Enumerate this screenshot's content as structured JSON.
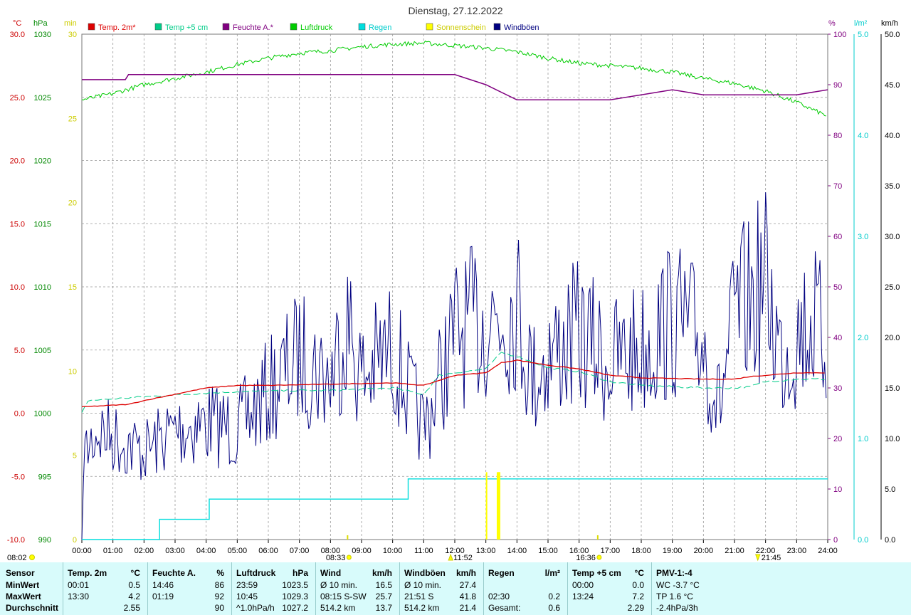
{
  "chart_data": {
    "type": "line",
    "title": "Dienstag, 27.12.2022",
    "axes": {
      "temp": {
        "unit": "°C",
        "min": -10,
        "max": 30,
        "ticks": [
          "-10.0",
          "-5.0",
          "0.0",
          "5.0",
          "10.0",
          "15.0",
          "20.0",
          "25.0",
          "30.0"
        ],
        "color": "#cc0000"
      },
      "press": {
        "unit": "hPa",
        "min": 990,
        "max": 1030,
        "ticks": [
          "990",
          "995",
          "1000",
          "1005",
          "1010",
          "1015",
          "1020",
          "1025",
          "1030"
        ],
        "color": "#008800"
      },
      "sun": {
        "unit": "min",
        "min": 0,
        "max": 30,
        "ticks": [
          "0",
          "5",
          "10",
          "15",
          "20",
          "25",
          "30"
        ],
        "color": "#cccc00"
      },
      "hum": {
        "unit": "%",
        "min": 0,
        "max": 100,
        "ticks": [
          "0",
          "10",
          "20",
          "30",
          "40",
          "50",
          "60",
          "70",
          "80",
          "90",
          "100"
        ],
        "color": "#800080"
      },
      "rain": {
        "unit": "l/m²",
        "min": 0,
        "max": 5,
        "ticks": [
          "0.0",
          "1.0",
          "2.0",
          "3.0",
          "4.0",
          "5.0"
        ],
        "color": "#00cccc"
      },
      "wind": {
        "unit": "km/h",
        "min": 0,
        "max": 50,
        "ticks": [
          "0.0",
          "5.0",
          "10.0",
          "15.0",
          "20.0",
          "25.0",
          "30.0",
          "35.0",
          "40.0",
          "45.0",
          "50.0"
        ],
        "color": "#000000"
      }
    },
    "x_ticks": [
      "00:00",
      "01:00",
      "02:00",
      "03:00",
      "04:00",
      "05:00",
      "06:00",
      "07:00",
      "08:00",
      "09:00",
      "10:00",
      "11:00",
      "12:00",
      "13:00",
      "14:00",
      "15:00",
      "16:00",
      "17:00",
      "18:00",
      "19:00",
      "20:00",
      "21:00",
      "22:00",
      "23:00",
      "24:00"
    ],
    "legend": [
      {
        "name": "Temp. 2m*",
        "color": "#dd0000"
      },
      {
        "name": "Temp +5 cm",
        "color": "#00cc88"
      },
      {
        "name": "Feuchte A.*",
        "color": "#800080"
      },
      {
        "name": "Luftdruck",
        "color": "#00cc00"
      },
      {
        "name": "Regen",
        "color": "#00dddd"
      },
      {
        "name": "Sonnenschein",
        "color": "#ffff00"
      },
      {
        "name": "Windböen",
        "color": "#000080"
      }
    ],
    "series": {
      "temp2m": [
        [
          0,
          0.5
        ],
        [
          1.5,
          0.7
        ],
        [
          2,
          1.0
        ],
        [
          3,
          1.5
        ],
        [
          4,
          2.0
        ],
        [
          5,
          2.2
        ],
        [
          6,
          2.2
        ],
        [
          8,
          2.3
        ],
        [
          10,
          2.4
        ],
        [
          11,
          2.2
        ],
        [
          11.5,
          2.6
        ],
        [
          12,
          3.0
        ],
        [
          13,
          3.2
        ],
        [
          13.5,
          4.0
        ],
        [
          14,
          4.2
        ],
        [
          15,
          3.8
        ],
        [
          16,
          3.5
        ],
        [
          17,
          3.0
        ],
        [
          18,
          2.8
        ],
        [
          20,
          2.7
        ],
        [
          21,
          2.7
        ],
        [
          21.5,
          2.9
        ],
        [
          22,
          3.0
        ],
        [
          23,
          3.2
        ],
        [
          24,
          3.2
        ]
      ],
      "temp5cm": [
        [
          0,
          0.0
        ],
        [
          0.2,
          1.0
        ],
        [
          2,
          1.3
        ],
        [
          4,
          1.6
        ],
        [
          5,
          1.7
        ],
        [
          7,
          1.8
        ],
        [
          8,
          1.8
        ],
        [
          10,
          2.0
        ],
        [
          11,
          1.5
        ],
        [
          11.5,
          3.0
        ],
        [
          12,
          3.2
        ],
        [
          13,
          3.5
        ],
        [
          13.5,
          4.8
        ],
        [
          14,
          4.5
        ],
        [
          15,
          3.6
        ],
        [
          16,
          3.3
        ],
        [
          17,
          2.5
        ],
        [
          18,
          2.2
        ],
        [
          20,
          2.0
        ],
        [
          21,
          2.0
        ],
        [
          21.5,
          2.1
        ],
        [
          22,
          2.5
        ],
        [
          23,
          2.7
        ],
        [
          24,
          2.7
        ]
      ],
      "humidity": [
        [
          0,
          91
        ],
        [
          1.4,
          91
        ],
        [
          1.5,
          92
        ],
        [
          12,
          92
        ],
        [
          13,
          90
        ],
        [
          14,
          87
        ],
        [
          15,
          87
        ],
        [
          17,
          87
        ],
        [
          18,
          88
        ],
        [
          19,
          89
        ],
        [
          20,
          88
        ],
        [
          22,
          88
        ],
        [
          23,
          88
        ],
        [
          24,
          89
        ]
      ],
      "pressure": [
        [
          0,
          1024.8
        ],
        [
          1,
          1025.3
        ],
        [
          2,
          1026.0
        ],
        [
          3,
          1026.5
        ],
        [
          4,
          1027.0
        ],
        [
          5,
          1027.6
        ],
        [
          6,
          1028.1
        ],
        [
          7,
          1028.5
        ],
        [
          8,
          1028.7
        ],
        [
          9,
          1029.0
        ],
        [
          10,
          1029.2
        ],
        [
          11,
          1029.3
        ],
        [
          12,
          1029.1
        ],
        [
          13,
          1028.9
        ],
        [
          14,
          1028.6
        ],
        [
          15,
          1028.1
        ],
        [
          16,
          1027.7
        ],
        [
          17,
          1027.5
        ],
        [
          18,
          1027.3
        ],
        [
          19,
          1027.0
        ],
        [
          20,
          1026.5
        ],
        [
          21,
          1026.1
        ],
        [
          22,
          1025.5
        ],
        [
          23,
          1024.6
        ],
        [
          24,
          1023.5
        ]
      ],
      "rain": [
        [
          0,
          0
        ],
        [
          2.5,
          0
        ],
        [
          2.5,
          0.2
        ],
        [
          4.1,
          0.2
        ],
        [
          4.1,
          0.4
        ],
        [
          10.5,
          0.4
        ],
        [
          10.5,
          0.6
        ],
        [
          24,
          0.6
        ]
      ],
      "sunshine": [
        [
          13.0,
          2.5
        ],
        [
          13.35,
          2.5
        ],
        [
          13.4,
          2.5
        ]
      ],
      "wind_gusts_envelope": [
        [
          0,
          11
        ],
        [
          0.5,
          15
        ],
        [
          1,
          14
        ],
        [
          2,
          12
        ],
        [
          3,
          15
        ],
        [
          4,
          16
        ],
        [
          5,
          15
        ],
        [
          6,
          20
        ],
        [
          7,
          25
        ],
        [
          8,
          22
        ],
        [
          8.5,
          30
        ],
        [
          9,
          22
        ],
        [
          10,
          26
        ],
        [
          10.5,
          20
        ],
        [
          11,
          15
        ],
        [
          12,
          28
        ],
        [
          13,
          30
        ],
        [
          14,
          32
        ],
        [
          14.5,
          22
        ],
        [
          15,
          25
        ],
        [
          16,
          28
        ],
        [
          17,
          24
        ],
        [
          18,
          26
        ],
        [
          19,
          30
        ],
        [
          20,
          27
        ],
        [
          20.5,
          18
        ],
        [
          21,
          30
        ],
        [
          22,
          35
        ],
        [
          22.5,
          25
        ],
        [
          23,
          28
        ],
        [
          23.5,
          30
        ],
        [
          24,
          26
        ]
      ]
    },
    "markers": {
      "sunrise": "08:33",
      "sunset": "16:36",
      "noon": "11:52",
      "max_wind": "21:45",
      "left_label": "08:02"
    }
  },
  "stats": {
    "row_labels": [
      "Sensor",
      "MinWert",
      "MaxWert",
      "Durchschnitt"
    ],
    "columns": [
      {
        "title": "Temp. 2m",
        "unit": "°C",
        "rows": [
          [
            "00:01",
            "0.5"
          ],
          [
            "13:30",
            "4.2"
          ],
          [
            "",
            "2.55"
          ]
        ]
      },
      {
        "title": "Feuchte A.",
        "unit": "%",
        "rows": [
          [
            "14:46",
            "86"
          ],
          [
            "01:19",
            "92"
          ],
          [
            "",
            "90"
          ]
        ]
      },
      {
        "title": "Luftdruck",
        "unit": "hPa",
        "rows": [
          [
            "23:59",
            "1023.5"
          ],
          [
            "10:45",
            "1029.3"
          ],
          [
            "^1.0hPa/h",
            "1027.2"
          ]
        ]
      },
      {
        "title": "Wind",
        "unit": "km/h",
        "rows": [
          [
            "Ø 10 min.",
            "16.5"
          ],
          [
            "08:15  S-SW",
            "25.7"
          ],
          [
            "514.2 km",
            "13.7"
          ]
        ]
      },
      {
        "title": "Windböen",
        "unit": "km/h",
        "rows": [
          [
            "Ø 10 min.",
            "27.4"
          ],
          [
            "21:51  S",
            "41.8"
          ],
          [
            "514.2 km",
            "21.4"
          ]
        ]
      },
      {
        "title": "Regen",
        "unit": "l/m²",
        "rows": [
          [
            "",
            ""
          ],
          [
            "02:30",
            "0.2"
          ],
          [
            "Gesamt:",
            "0.6"
          ]
        ]
      },
      {
        "title": "Temp +5 cm",
        "unit": "°C",
        "rows": [
          [
            "00:00",
            "0.0"
          ],
          [
            "13:24",
            "7.2"
          ],
          [
            "",
            "2.29"
          ]
        ]
      },
      {
        "title": "PMV-1:-4",
        "unit": "",
        "rows": [
          [
            "WC -3.7 °C",
            ""
          ],
          [
            "TP 1.6 °C",
            ""
          ],
          [
            "-2.4hPa/3h",
            ""
          ]
        ]
      }
    ]
  }
}
